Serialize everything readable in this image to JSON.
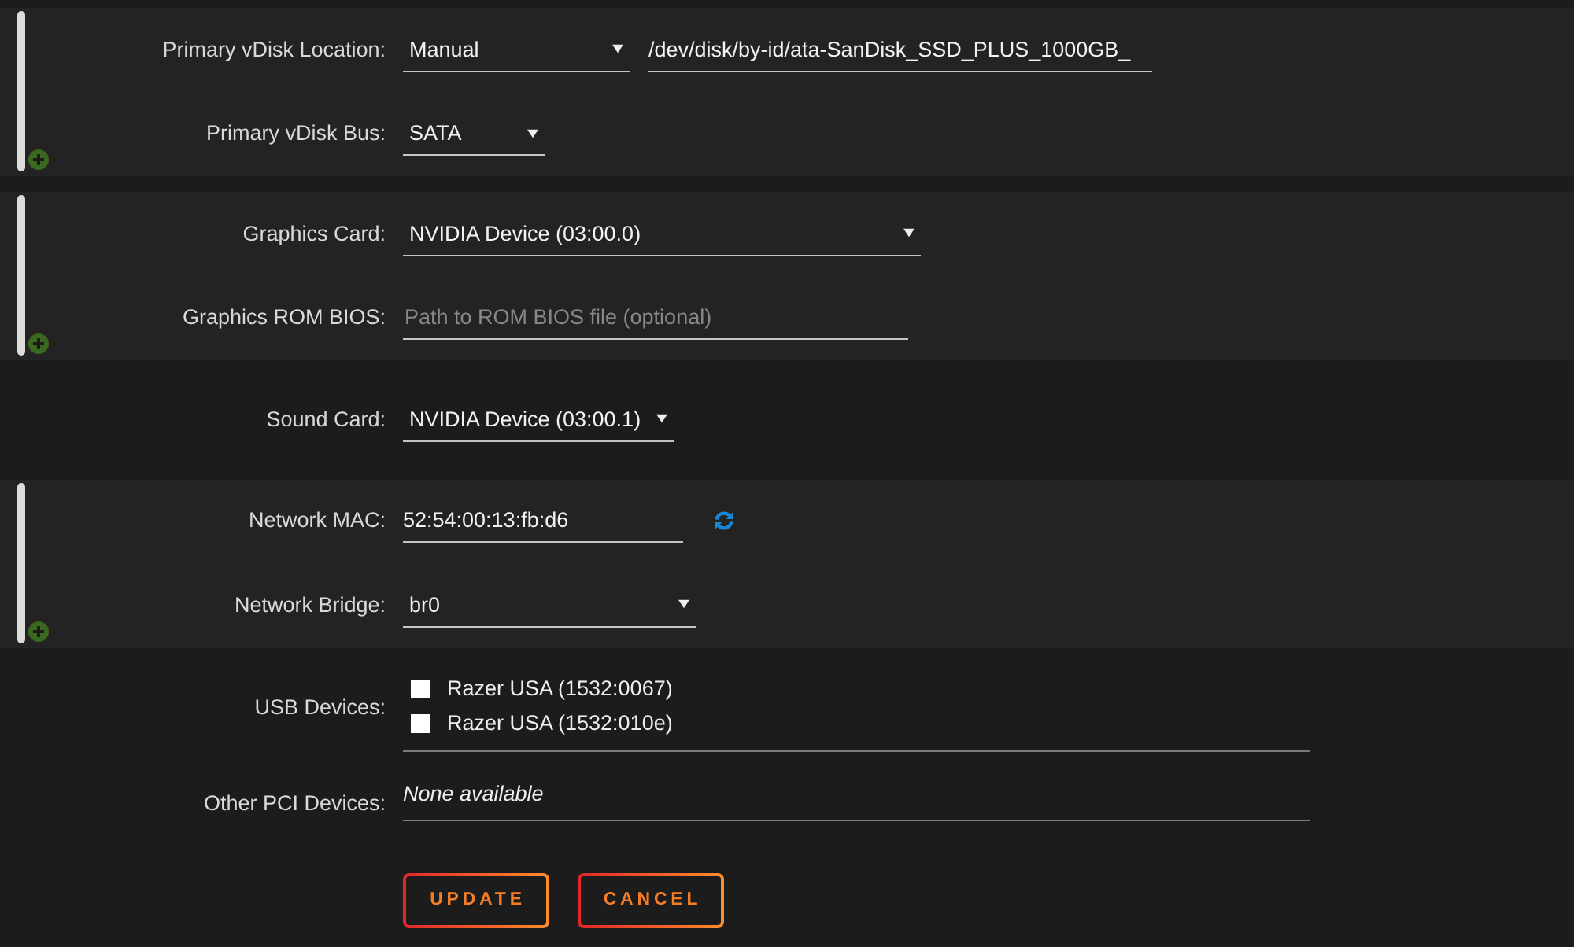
{
  "sections": [
    {
      "grouped": true,
      "rows": [
        {
          "label": "Primary vDisk Location:",
          "fields": [
            {
              "kind": "select",
              "value": "Manual"
            },
            {
              "kind": "text",
              "value": "/dev/disk/by-id/ata-SanDisk_SSD_PLUS_1000GB_"
            }
          ]
        },
        {
          "label": "Primary vDisk Bus:",
          "fields": [
            {
              "kind": "select",
              "value": "SATA"
            }
          ]
        }
      ]
    },
    {
      "grouped": true,
      "rows": [
        {
          "label": "Graphics Card:",
          "fields": [
            {
              "kind": "select",
              "value": "NVIDIA Device (03:00.0)"
            }
          ]
        },
        {
          "label": "Graphics ROM BIOS:",
          "fields": [
            {
              "kind": "text",
              "placeholder": "Path to ROM BIOS file (optional)"
            }
          ]
        }
      ]
    },
    {
      "grouped": false,
      "rows": [
        {
          "label": "Sound Card:",
          "fields": [
            {
              "kind": "select",
              "value": "NVIDIA Device (03:00.1)"
            }
          ]
        }
      ]
    },
    {
      "grouped": true,
      "rows": [
        {
          "label": "Network MAC:",
          "fields": [
            {
              "kind": "text",
              "value": "52:54:00:13:fb:d6",
              "refresh": true
            }
          ]
        },
        {
          "label": "Network Bridge:",
          "fields": [
            {
              "kind": "select",
              "value": "br0"
            }
          ]
        }
      ]
    },
    {
      "grouped": false,
      "rows": [
        {
          "label": "USB Devices:",
          "fields": [
            {
              "kind": "checklist",
              "items": [
                {
                  "label": "Razer USA (1532:0067)",
                  "checked": false
                },
                {
                  "label": "Razer USA (1532:010e)",
                  "checked": false
                }
              ]
            }
          ]
        },
        {
          "label": "Other PCI Devices:",
          "fields": [
            {
              "kind": "note",
              "value": "None available"
            }
          ]
        }
      ]
    }
  ],
  "buttons": [
    "UPDATE",
    "CANCEL"
  ]
}
